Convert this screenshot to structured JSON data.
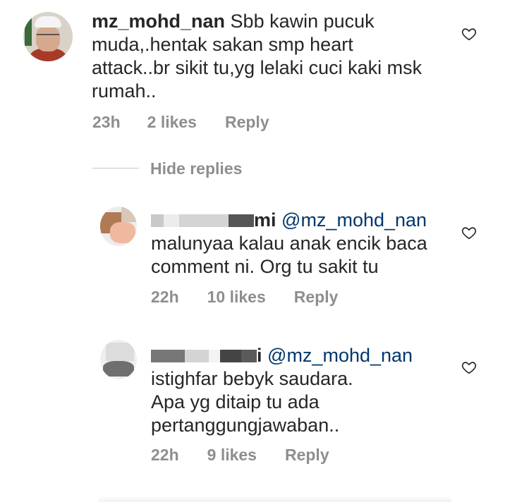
{
  "comment": {
    "username": "mz_mohd_nan",
    "text_lines": [
      "Sbb kawin pucuk",
      "muda,.hentak sakan smp heart",
      "attack..br sikit tu,yg lelaki  cuci kaki msk",
      "rumah.."
    ],
    "time": "23h",
    "likes": "2 likes",
    "reply_label": "Reply"
  },
  "hide_replies_label": "Hide replies",
  "replies": [
    {
      "username_visible_suffix": "mi",
      "mention": "@mz_mohd_nan",
      "text_lines": [
        "malunyaa kalau anak encik baca",
        "comment ni. Org tu sakit tu"
      ],
      "time": "22h",
      "likes": "10 likes",
      "reply_label": "Reply"
    },
    {
      "username_visible_suffix": "i",
      "mention": "@mz_mohd_nan",
      "text_lines": [
        "istighfar bebyk saudara.",
        "Apa yg ditaip tu ada",
        "pertanggungjawaban.."
      ],
      "time": "22h",
      "likes": "9 likes",
      "reply_label": "Reply"
    }
  ],
  "icons": {
    "like": "heart-outline-icon"
  },
  "colors": {
    "text": "#262626",
    "meta": "#8e8e8e",
    "mention": "#00376b"
  }
}
